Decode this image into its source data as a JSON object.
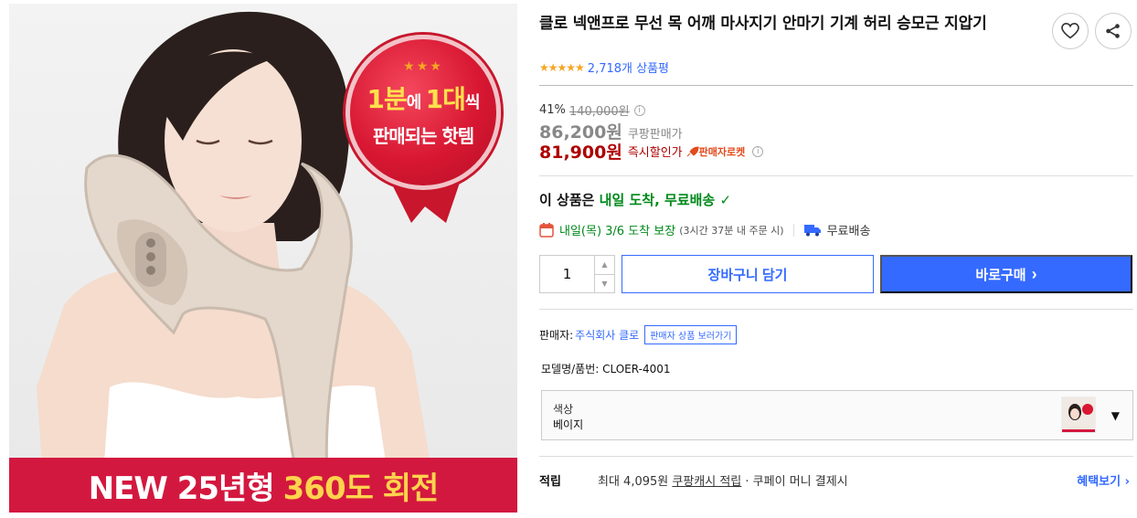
{
  "image": {
    "badge": {
      "stars": "★★★",
      "line1_a": "1분",
      "line1_b": "에 ",
      "line1_c": "1대",
      "line1_d": "씩",
      "line2": "판매되는 핫템"
    },
    "banner": {
      "prefix": "NEW 25년형 ",
      "highlight": "360도 회전"
    }
  },
  "product": {
    "title": "클로 넥앤프로 무선 목 어깨 마사지기 안마기 기계 허리 승모근 지압기",
    "stars": "★★★★★",
    "review_count": "2,718개 상품평"
  },
  "pricing": {
    "discount_rate": "41%",
    "original_price": "140,000원",
    "coupang_price": "86,200원",
    "coupang_price_label": "쿠팡판매가",
    "instant_price": "81,900원",
    "instant_price_label": "즉시할인가",
    "rocket_label": "판매자로켓",
    "info_glyph": "i"
  },
  "delivery": {
    "headline_prefix": "이 상품은 ",
    "headline_green": "내일 도착, 무료배송",
    "headline_check": "✓",
    "date": "내일(목) 3/6 도착 보장",
    "cutoff": "(3시간 37분 내 주문 시)",
    "free": "무료배송"
  },
  "purchase": {
    "quantity": "1",
    "qty_up": "▲",
    "qty_down": "▼",
    "cart_label": "장바구니 담기",
    "buy_label": "바로구매",
    "buy_chevron": "›"
  },
  "seller": {
    "label": "판매자:",
    "name": "주식회사 클로",
    "more": "판매자 상품 보러가기"
  },
  "model": {
    "text": "모델명/품번:  CLOER-4001"
  },
  "option": {
    "key": "색상",
    "value": "베이지",
    "caret": "▼"
  },
  "reward": {
    "label": "적립",
    "text_a": "최대 4,095원 ",
    "text_u": "쿠팡캐시 적립",
    "text_b": " · 쿠페이 머니 결제시",
    "more": "혜택보기 ›"
  },
  "colors": {
    "accent_blue": "#346aff",
    "price_red": "#ae0000",
    "delivery_green": "#00891a",
    "badge_red": "#d81732",
    "banner_red": "#d3183f"
  },
  "icons": [
    "heart-icon",
    "share-icon",
    "calendar-icon",
    "truck-icon",
    "rocket-icon",
    "info-icon",
    "check-icon",
    "chevron-down-icon"
  ]
}
